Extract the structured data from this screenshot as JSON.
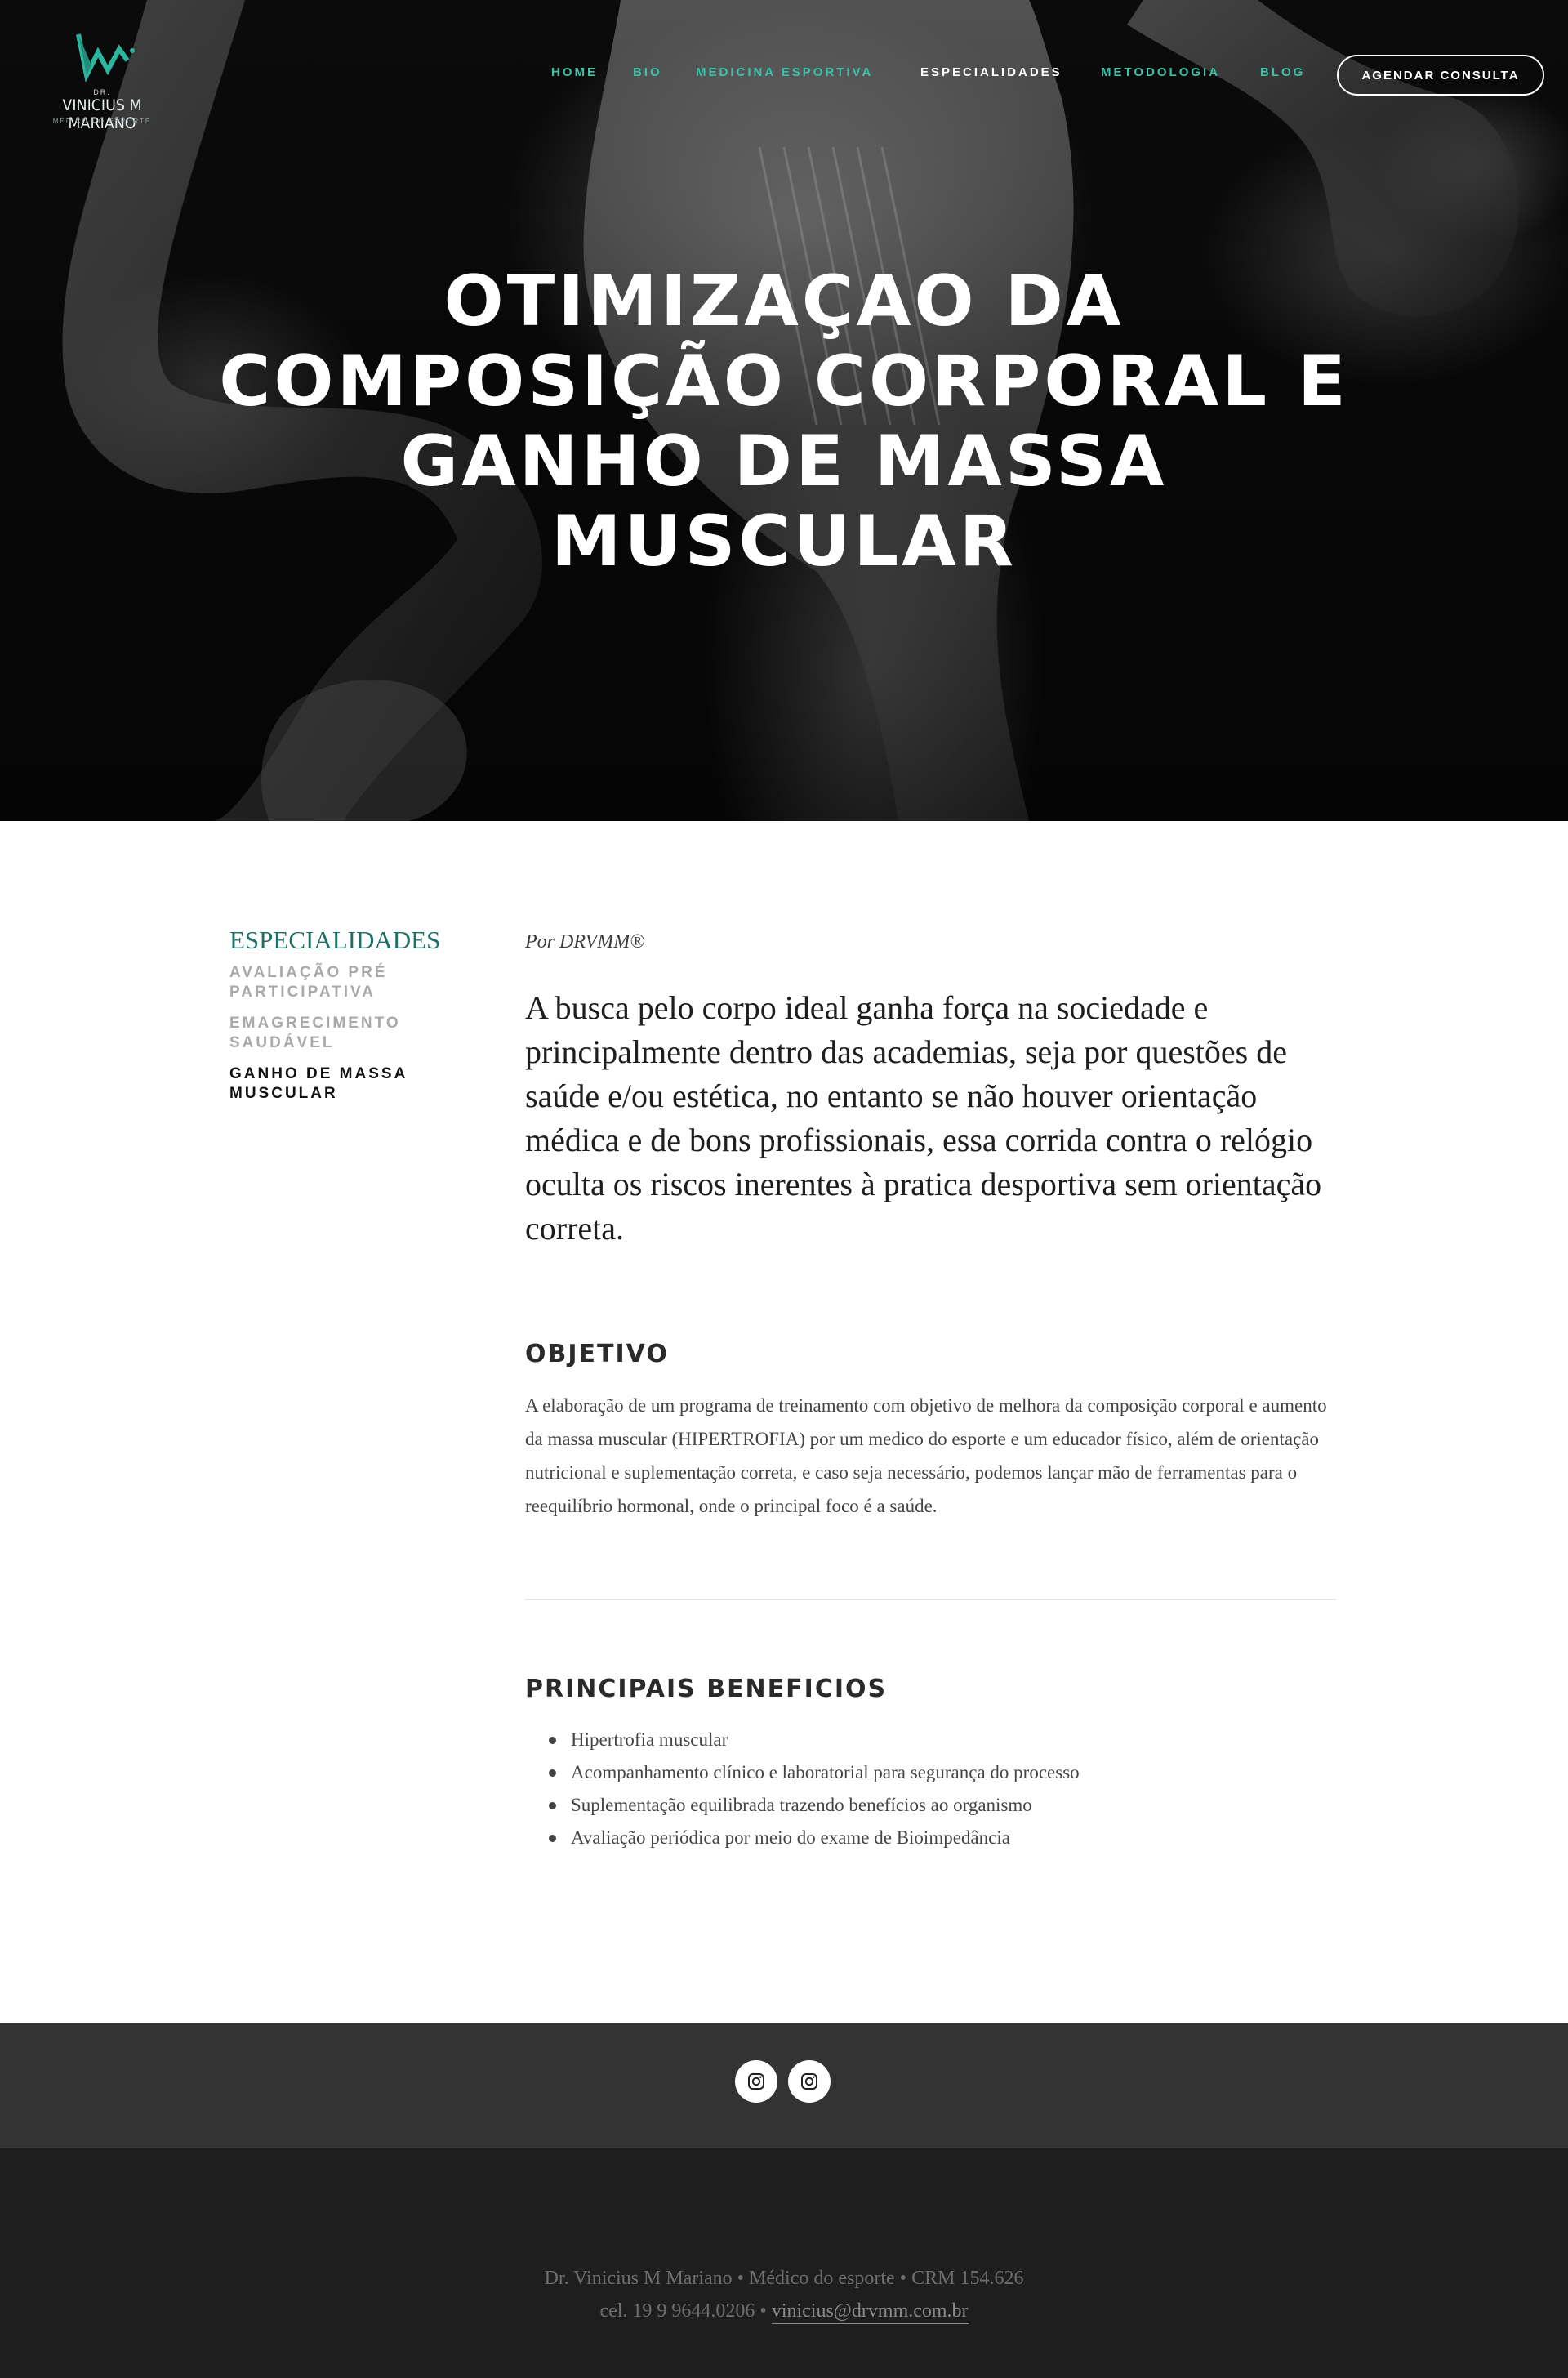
{
  "brand": {
    "small": "DR.",
    "name": "VINICIUS M MARIANO",
    "tagline": "MÉDICO DO ESPORTE",
    "accent": "#3cc2a9"
  },
  "nav": {
    "items": [
      {
        "label": "HOME"
      },
      {
        "label": "BIO"
      },
      {
        "label": "MEDICINA ESPORTIVA"
      },
      {
        "label": "ESPECIALIDADES"
      },
      {
        "label": "METODOLOGIA"
      },
      {
        "label": "BLOG"
      }
    ],
    "cta": "AGENDAR CONSULTA"
  },
  "hero": {
    "title": "OTIMIZAÇAO DA COMPOSIÇÃO CORPORAL E GANHO DE MASSA MUSCULAR"
  },
  "sidebar": {
    "title": "ESPECIALIDADES",
    "items": [
      {
        "label": "AVALIAÇÃO PRÉ PARTICIPATIVA"
      },
      {
        "label": "EMAGRECIMENTO SAUDÁVEL"
      },
      {
        "label": "GANHO DE MASSA MUSCULAR"
      }
    ],
    "title_color": "#1e6f66"
  },
  "article": {
    "byline": "Por DRVMM®",
    "lead": "A busca pelo corpo ideal ganha força na sociedade e principalmente dentro das academias, seja por questões de saúde e/ou estética, no entanto se não houver orientação médica e de bons profissionais, essa corrida contra o relógio oculta os riscos inerentes à pratica desportiva sem orientação correta.",
    "objective_heading": "OBJETIVO",
    "objective_text": "A elaboração de um programa de treinamento com objetivo de melhora da composição corporal e aumento da massa muscular (HIPERTROFIA) por um medico do esporte e um educador físico, além de orientação nutricional e suplementação correta, e caso seja necessário, podemos lançar mão de ferramentas para o reequilíbrio hormonal, onde o principal foco é a saúde.",
    "benefits_heading": "PRINCIPAIS BENEFICIOS",
    "benefits": [
      "Hipertrofia muscular",
      "Acompanhamento clínico e laboratorial para segurança do processo",
      "Suplementação equilibrada trazendo benefícios ao organismo",
      "Avaliação periódica por meio do exame de Bioimpedância"
    ]
  },
  "social": {
    "icons": [
      "instagram-icon",
      "instagram-icon"
    ]
  },
  "footer": {
    "line1": "Dr. Vinicius M Mariano • Médico do esporte • CRM 154.626",
    "line2_prefix": "cel. 19 9 9644.0206 • ",
    "email": "vinicius@drvmm.com.br"
  }
}
